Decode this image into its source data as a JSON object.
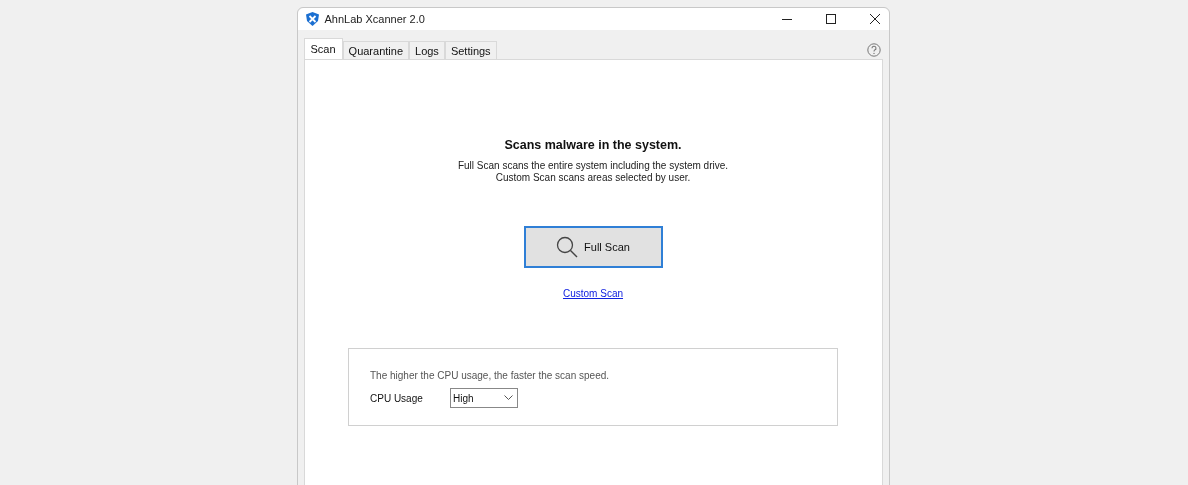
{
  "window": {
    "title": "AhnLab Xcanner 2.0"
  },
  "tabs": [
    {
      "label": "Scan",
      "selected": true
    },
    {
      "label": "Quarantine",
      "selected": false
    },
    {
      "label": "Logs",
      "selected": false
    },
    {
      "label": "Settings",
      "selected": false
    }
  ],
  "scan": {
    "heading": "Scans malware in the system.",
    "description": [
      "Full Scan scans the entire system including the system drive.",
      "Custom Scan scans areas selected by user."
    ],
    "primary_button": "Full Scan",
    "link": "Custom Scan"
  },
  "cpu": {
    "hint": "The higher the CPU usage, the faster the scan speed.",
    "label": "CPU Usage",
    "value": "High"
  }
}
